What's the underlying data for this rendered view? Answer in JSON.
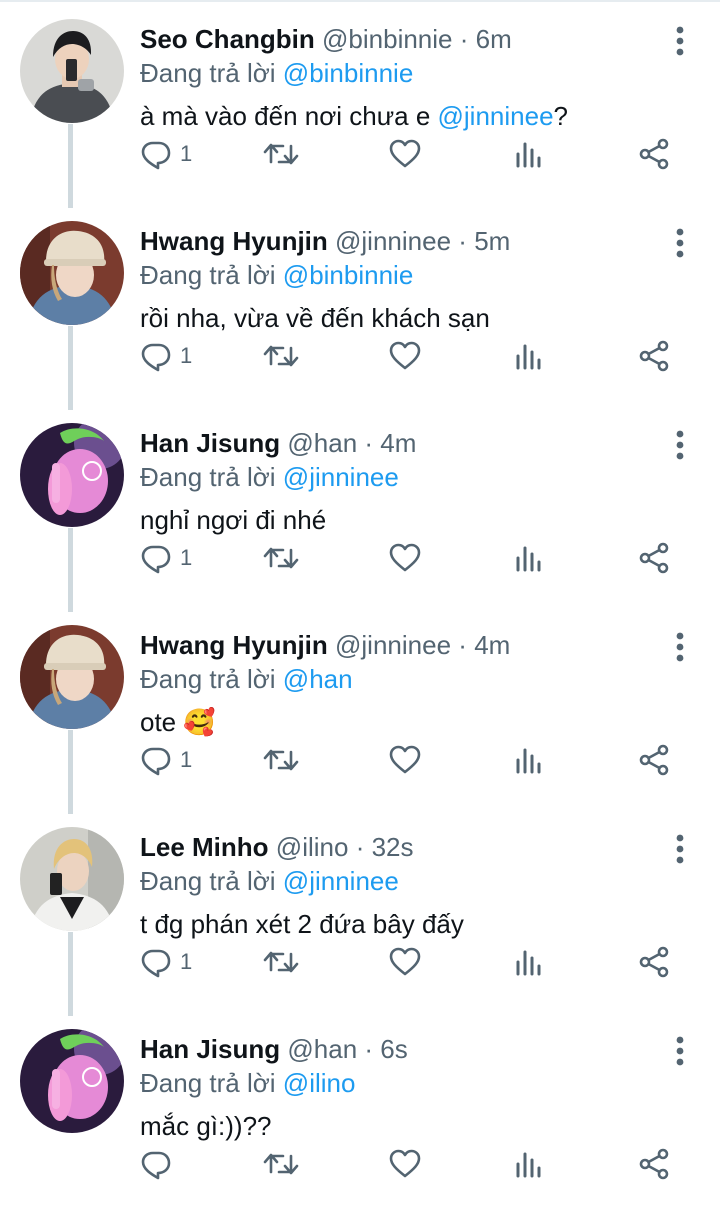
{
  "reply_prefix": "Đang trả lời",
  "tweets": [
    {
      "name": "Seo Changbin",
      "handle": "@binbinnie",
      "time": "6m",
      "reply_to": "@binbinnie",
      "text_before": "à mà vào đến nơi chưa e ",
      "text_mention": "@jinninee",
      "text_after": "?",
      "replies": "1",
      "avatar_icon": "avatar-seo-changbin"
    },
    {
      "name": "Hwang Hyunjin",
      "handle": "@jinninee",
      "time": "5m",
      "reply_to": "@binbinnie",
      "text_before": "rồi nha, vừa về đến khách sạn",
      "text_mention": "",
      "text_after": "",
      "replies": "1",
      "avatar_icon": "avatar-hwang-hyunjin"
    },
    {
      "name": "Han Jisung",
      "handle": "@han",
      "time": "4m",
      "reply_to": "@jinninee",
      "text_before": "nghỉ ngơi đi nhé",
      "text_mention": "",
      "text_after": "",
      "replies": "1",
      "avatar_icon": "avatar-han-jisung"
    },
    {
      "name": "Hwang Hyunjin",
      "handle": "@jinninee",
      "time": "4m",
      "reply_to": "@han",
      "text_before": "ote 🥰",
      "text_mention": "",
      "text_after": "",
      "replies": "1",
      "avatar_icon": "avatar-hwang-hyunjin"
    },
    {
      "name": "Lee Minho",
      "handle": "@ilino",
      "time": "32s",
      "reply_to": "@jinninee",
      "text_before": "t đg phán xét 2 đứa bây đấy",
      "text_mention": "",
      "text_after": "",
      "replies": "1",
      "avatar_icon": "avatar-lee-minho"
    },
    {
      "name": "Han Jisung",
      "handle": "@han",
      "time": "6s",
      "reply_to": "@ilino",
      "text_before": "mắc gì:))??",
      "text_mention": "",
      "text_after": "",
      "replies": "",
      "avatar_icon": "avatar-han-jisung"
    }
  ],
  "colors": {
    "link": "#1d9bf0",
    "secondary_text": "#536471",
    "thread_line": "#cfd9de"
  }
}
